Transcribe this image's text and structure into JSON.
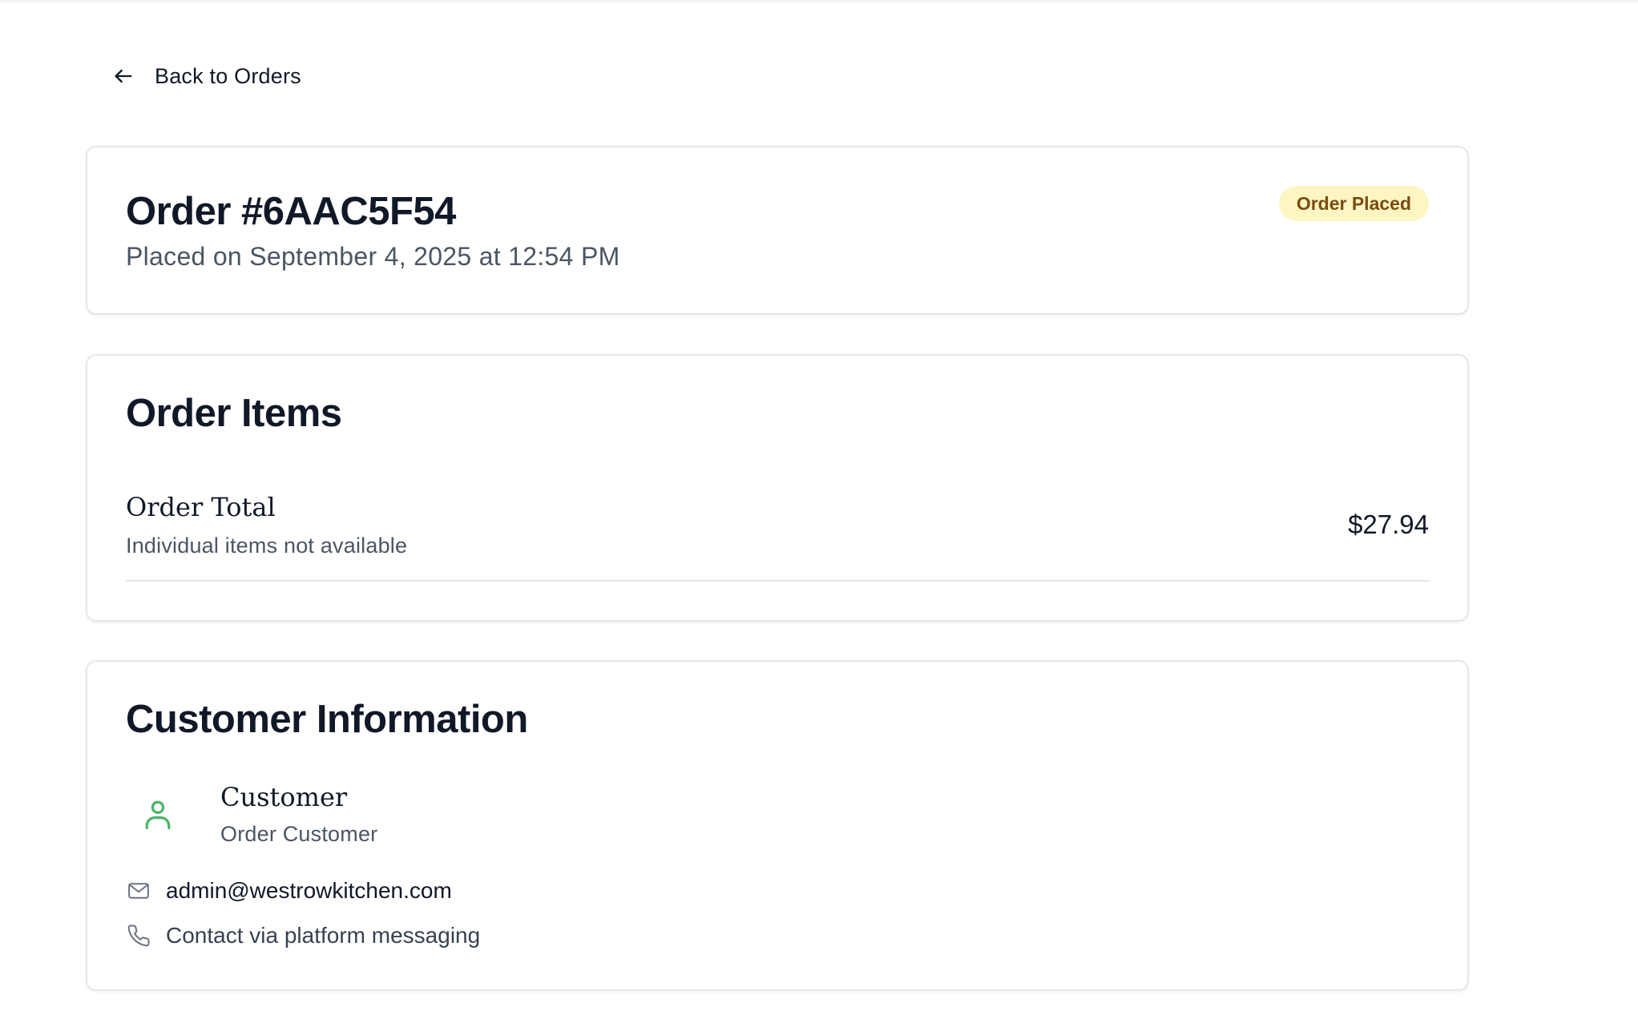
{
  "nav": {
    "back_label": "Back to Orders",
    "back_icon": "arrow-left-icon"
  },
  "order": {
    "title": "Order #6AAC5F54",
    "placed_on": "Placed on September 4, 2025 at 12:54 PM",
    "status": "Order Placed"
  },
  "items_section": {
    "title": "Order Items",
    "rows": [
      {
        "name": "Order Total",
        "note": "Individual items not available",
        "amount": "$27.94"
      }
    ]
  },
  "customer_section": {
    "title": "Customer Information",
    "name": "Customer",
    "role": "Order Customer",
    "avatar_icon": "user-icon",
    "email": "admin@westrowkitchen.com",
    "email_icon": "mail-icon",
    "phone": "Contact via platform messaging",
    "phone_icon": "phone-icon"
  },
  "colors": {
    "badge_bg": "#fdf6c3",
    "badge_text": "#7a4b12",
    "avatar_accent": "#4cb56a",
    "border": "#e5e7eb",
    "muted_text": "#4b5563"
  }
}
